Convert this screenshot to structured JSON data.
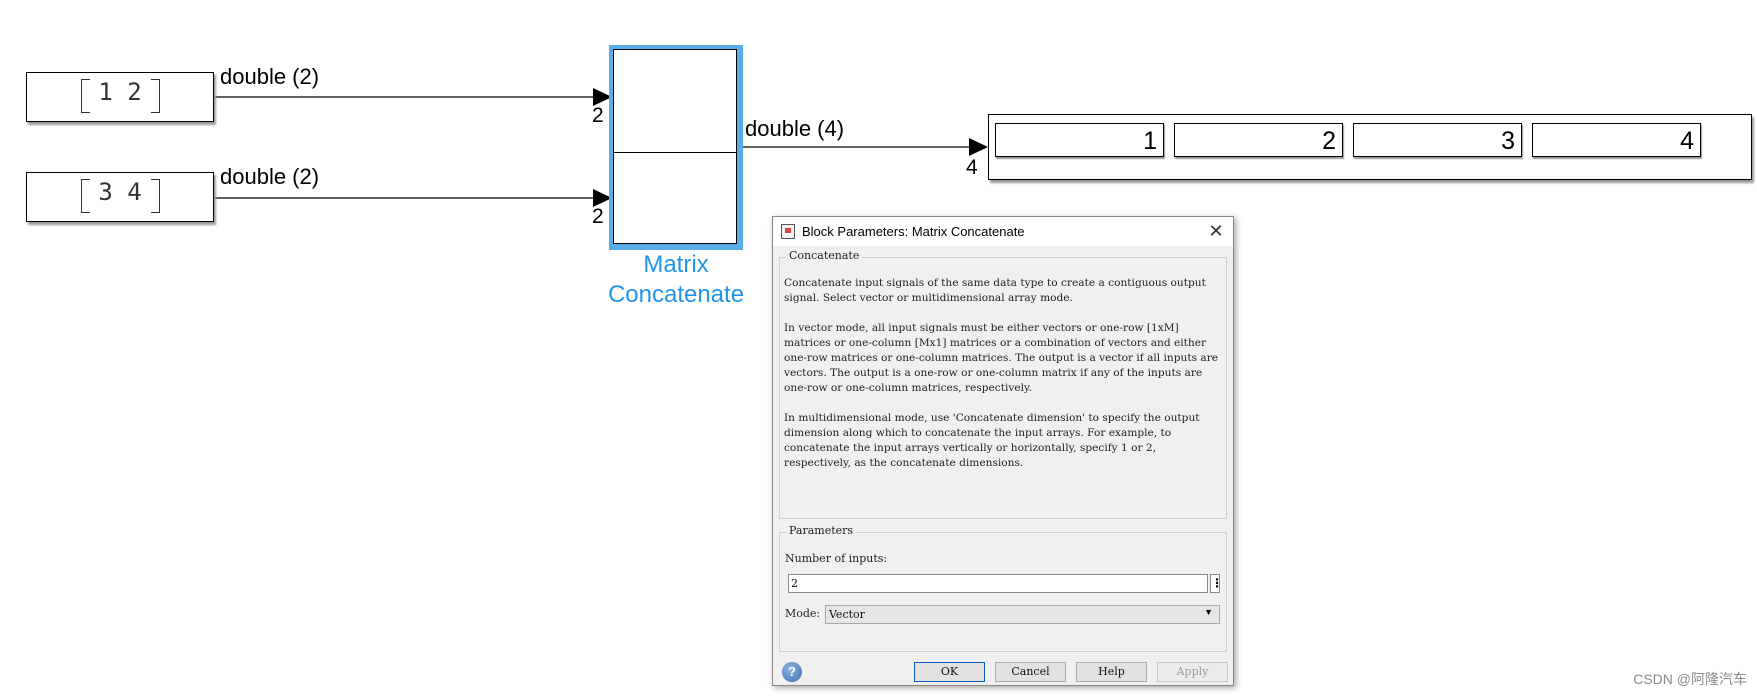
{
  "model": {
    "constants": [
      {
        "value": "1  2",
        "signal_label": "double (2)",
        "port_label": "2"
      },
      {
        "value": "3  4",
        "signal_label": "double (2)",
        "port_label": "2"
      }
    ],
    "concat_block": {
      "name": "Matrix\nConcatenate",
      "name_line1": "Matrix",
      "name_line2": "Concatenate"
    },
    "output_signal_label": "double (4)",
    "output_port_label": "4",
    "display_values": [
      "1",
      "2",
      "3",
      "4"
    ]
  },
  "dialog": {
    "title": "Block Parameters: Matrix Concatenate",
    "close_glyph": "✕",
    "concatenate_group": {
      "title": "Concatenate",
      "paragraphs": [
        "Concatenate input signals of the same data type to create a contiguous output signal. Select vector or multidimensional array mode.",
        "In vector mode, all input signals must be either vectors or one-row [1xM] matrices or one-column [Mx1] matrices or a combination of vectors and either one-row matrices or one-column matrices. The output is a vector if all inputs are vectors. The output is a one-row or one-column matrix if any of the inputs are one-row or one-column matrices, respectively.",
        "In multidimensional mode, use 'Concatenate dimension' to specify the output dimension along which to concatenate the input arrays. For example, to concatenate the input arrays vertically or horizontally, specify 1 or 2, respectively, as the concatenate dimensions."
      ]
    },
    "parameters_group": {
      "title": "Parameters",
      "num_inputs_label": "Number of inputs:",
      "num_inputs_value": "2",
      "more_glyph": "⋮",
      "mode_label": "Mode:",
      "mode_value": "Vector",
      "mode_arrow": "▼"
    },
    "help_glyph": "?",
    "buttons": {
      "ok": "OK",
      "cancel": "Cancel",
      "help": "Help",
      "apply": "Apply"
    }
  },
  "watermark": "CSDN @阿隆汽车",
  "colors": {
    "selection": "#5aaee8",
    "block_label": "#2196e8",
    "ok_border": "#0a5cc4"
  }
}
